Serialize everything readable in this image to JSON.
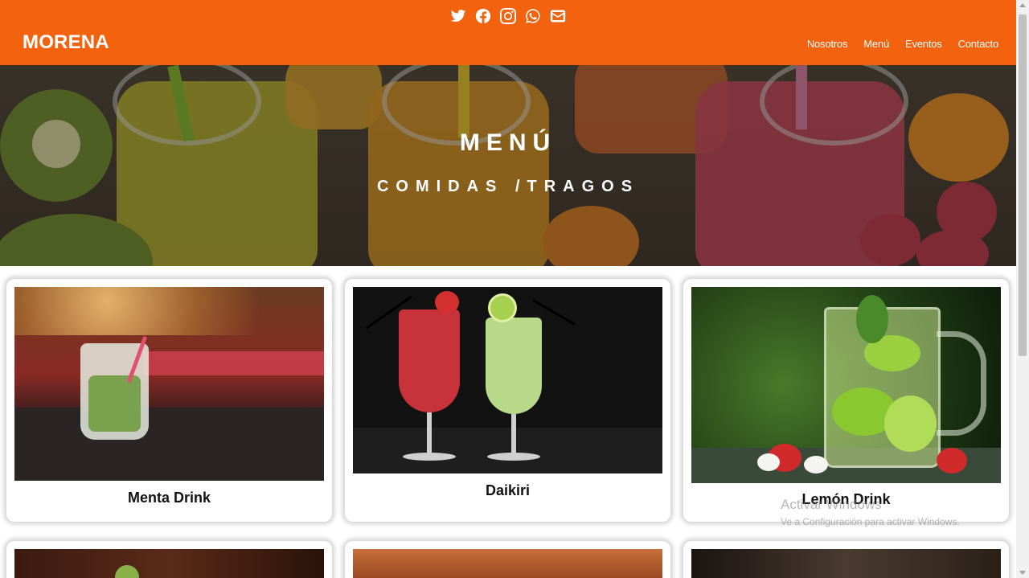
{
  "header": {
    "brand": "MORENA",
    "nav": [
      "Nosotros",
      "Menú",
      "Eventos",
      "Contacto"
    ],
    "social_icons": [
      "twitter-icon",
      "facebook-icon",
      "instagram-icon",
      "whatsapp-icon",
      "email-icon"
    ],
    "background_color": "#f2620f"
  },
  "hero": {
    "title": "MENÚ",
    "subtitle": "COMIDAS /TRAGOS"
  },
  "cards": [
    {
      "name": "Menta Drink"
    },
    {
      "name": "Daikiri"
    },
    {
      "name": "Lemón Drink"
    }
  ],
  "watermark": {
    "line1": "Activar Windows",
    "line2": "Ve a Configuración para activar Windows."
  }
}
